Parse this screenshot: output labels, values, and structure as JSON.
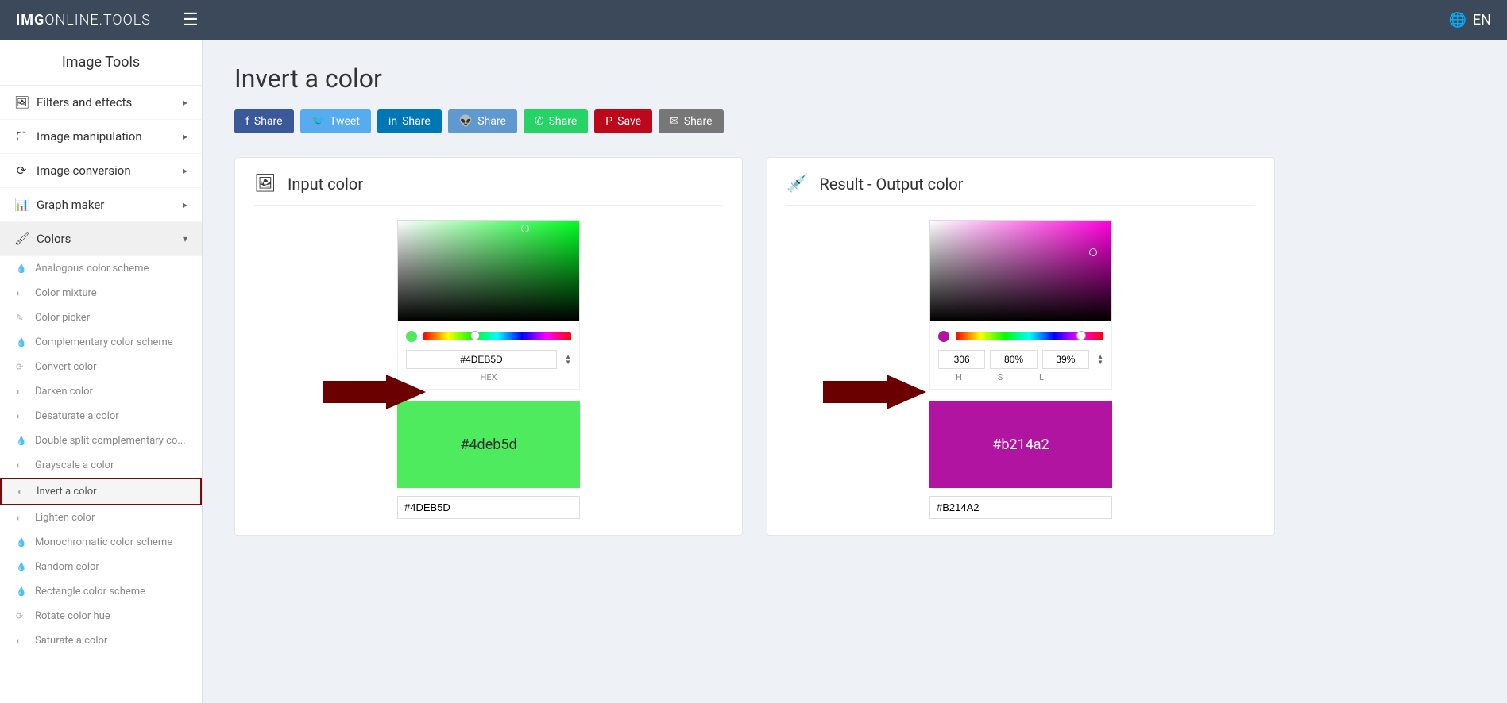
{
  "header": {
    "logo_bold": "IMG",
    "logo_thin": "ONLINE.TOOLS",
    "lang": "EN"
  },
  "sidebar": {
    "title": "Image Tools",
    "nav": [
      {
        "label": "Filters and effects"
      },
      {
        "label": "Image manipulation"
      },
      {
        "label": "Image conversion"
      },
      {
        "label": "Graph maker"
      },
      {
        "label": "Colors"
      }
    ],
    "colors_sub": [
      {
        "label": "Analogous color scheme"
      },
      {
        "label": "Color mixture"
      },
      {
        "label": "Color picker"
      },
      {
        "label": "Complementary color scheme"
      },
      {
        "label": "Convert color"
      },
      {
        "label": "Darken color"
      },
      {
        "label": "Desaturate a color"
      },
      {
        "label": "Double split complementary co..."
      },
      {
        "label": "Grayscale a color"
      },
      {
        "label": "Invert a color"
      },
      {
        "label": "Lighten color"
      },
      {
        "label": "Monochromatic color scheme"
      },
      {
        "label": "Random color"
      },
      {
        "label": "Rectangle color scheme"
      },
      {
        "label": "Rotate color hue"
      },
      {
        "label": "Saturate a color"
      }
    ]
  },
  "page": {
    "title": "Invert a color"
  },
  "share": {
    "fb": "Share",
    "tw": "Tweet",
    "li": "Share",
    "rd": "Share",
    "wa": "Share",
    "pin": "Save",
    "em": "Share"
  },
  "input_card": {
    "title": "Input color",
    "hex_value": "#4DEB5D",
    "hex_label": "HEX",
    "swatch_text": "#4deb5d",
    "display_value": "#4DEB5D",
    "preview_color": "#4deb5d"
  },
  "output_card": {
    "title": "Result - Output color",
    "h": "306",
    "s": "80%",
    "l": "39%",
    "h_label": "H",
    "s_label": "S",
    "l_label": "L",
    "swatch_text": "#b214a2",
    "display_value": "#B214A2",
    "preview_color": "#b214a2"
  }
}
